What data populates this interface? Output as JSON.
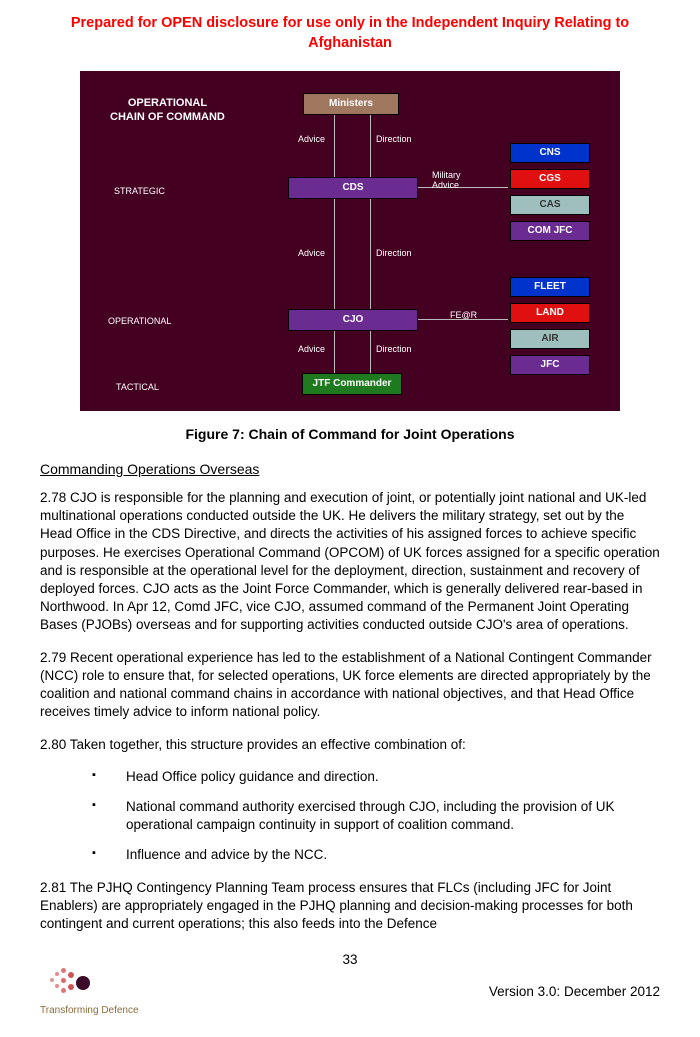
{
  "banner": "Prepared for OPEN disclosure for use only in the Independent Inquiry Relating to Afghanistan",
  "diagram": {
    "title": "OPERATIONAL\nCHAIN OF COMMAND",
    "levels": {
      "strategic": "STRATEGIC",
      "operational": "OPERATIONAL",
      "tactical": "TACTICAL"
    },
    "labels": {
      "advice": "Advice",
      "direction": "Direction",
      "military_advice": "Military\nAdvice",
      "fer": "FE@R"
    },
    "boxes": {
      "ministers": "Ministers",
      "cds": "CDS",
      "cjo": "CJO",
      "jtf": "JTF Commander",
      "cns": "CNS",
      "cgs": "CGS",
      "cas": "CAS",
      "comjfc": "COM JFC",
      "fleet": "FLEET",
      "land": "LAND",
      "air": "AIR",
      "jfc": "JFC"
    }
  },
  "caption": "Figure 7: Chain of Command for Joint Operations",
  "subhead": "Commanding Operations Overseas",
  "p278": "2.78 CJO is responsible for the planning and execution of joint, or potentially joint national and UK-led multinational operations conducted outside the UK.  He delivers the military strategy, set out by the Head Office in the CDS Directive, and directs the activities of his assigned forces to achieve specific purposes.  He exercises Operational Command (OPCOM) of UK forces assigned for a specific operation and is responsible at the operational level for the deployment, direction, sustainment and recovery of deployed forces.  CJO acts as the Joint Force Commander, which is generally delivered rear-based in Northwood.  In Apr 12, Comd JFC, vice CJO, assumed command of the Permanent Joint Operating Bases (PJOBs) overseas and for supporting activities conducted outside CJO's area of operations.",
  "p279": "2.79 Recent operational experience has led to the establishment of a National Contingent Commander (NCC) role to ensure that, for selected operations, UK force elements are directed appropriately by the coalition and national command chains in accordance with national objectives, and that Head Office receives timely advice to inform national policy.",
  "p280": "2.80 Taken together, this structure provides an effective combination of:",
  "bullets": [
    "Head Office policy guidance and direction.",
    "National command authority exercised through CJO, including the provision of UK operational campaign continuity in support of coalition command.",
    "Influence and advice by the NCC."
  ],
  "p281": "2.81 The PJHQ Contingency Planning Team process ensures that FLCs (including JFC for Joint Enablers) are appropriately engaged in the PJHQ planning and decision-making processes for both contingent and current operations; this also feeds into the Defence",
  "footer": {
    "logo_text": "Transforming Defence",
    "page": "33",
    "version": "Version 3.0: December 2012"
  }
}
